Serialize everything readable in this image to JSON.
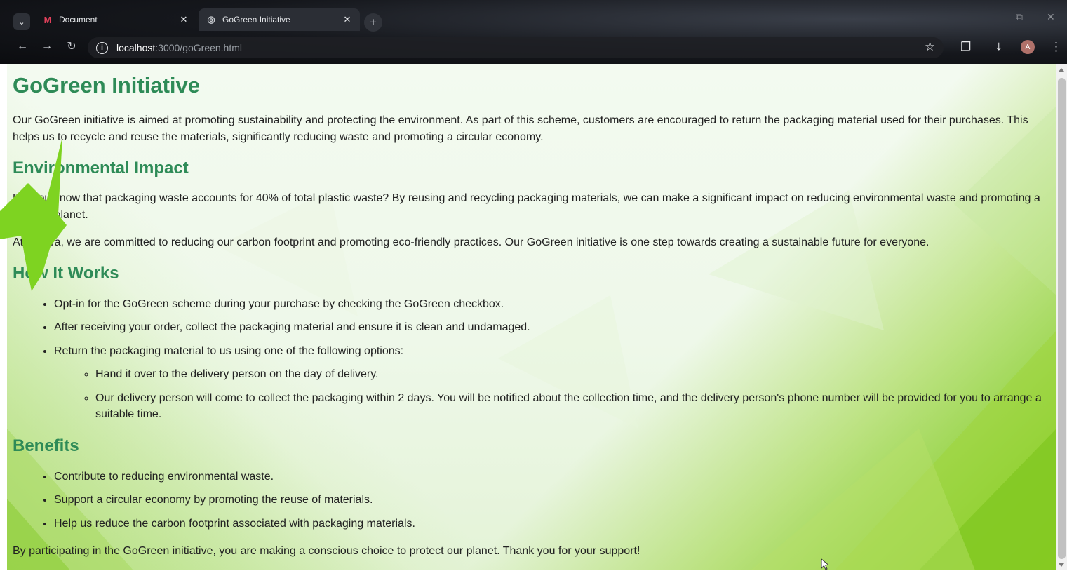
{
  "browser": {
    "tabs": [
      {
        "label": "Document",
        "icon": "myntra-m-icon",
        "active": false
      },
      {
        "label": "GoGreen Initiative",
        "icon": "globe-icon",
        "active": true
      }
    ],
    "url_host": "localhost",
    "url_path": ":3000/goGreen.html",
    "profile_initial": "A"
  },
  "page": {
    "title": "GoGreen Initiative",
    "intro": "Our GoGreen initiative is aimed at promoting sustainability and protecting the environment. As part of this scheme, customers are encouraged to return the packaging material used for their purchases. This helps us to recycle and reuse the materials, significantly reducing waste and promoting a circular economy.",
    "impact_heading": "Environmental Impact",
    "impact_p1": "Did you know that packaging waste accounts for 40% of total plastic waste? By reusing and recycling packaging materials, we can make a significant impact on reducing environmental waste and promoting a greener planet.",
    "impact_p2": "At Myntra, we are committed to reducing our carbon footprint and promoting eco-friendly practices. Our GoGreen initiative is one step towards creating a sustainable future for everyone.",
    "how_heading": "How It Works",
    "how_steps": [
      "Opt-in for the GoGreen scheme during your purchase by checking the GoGreen checkbox.",
      "After receiving your order, collect the packaging material and ensure it is clean and undamaged.",
      "Return the packaging material to us using one of the following options:"
    ],
    "return_options": [
      "Hand it over to the delivery person on the day of delivery.",
      "Our delivery person will come to collect the packaging within 2 days. You will be notified about the collection time, and the delivery person's phone number will be provided for you to arrange a suitable time."
    ],
    "benefits_heading": "Benefits",
    "benefits": [
      "Contribute to reducing environmental waste.",
      "Support a circular economy by promoting the reuse of materials.",
      "Help us reduce the carbon footprint associated with packaging materials."
    ],
    "closing": "By participating in the GoGreen initiative, you are making a conscious choice to protect our planet. Thank you for your support!"
  },
  "colors": {
    "heading": "#2e8b57",
    "text": "#222222",
    "arrow": "#7ed321",
    "accent_green": "#8ccd1e"
  }
}
